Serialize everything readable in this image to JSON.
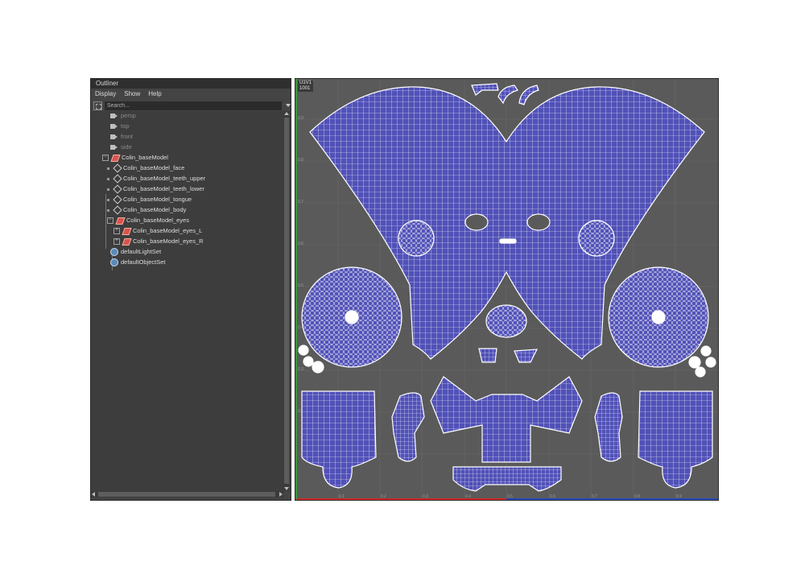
{
  "outliner": {
    "title": "Outliner",
    "menu": [
      "Display",
      "Show",
      "Help"
    ],
    "search_placeholder": "Search...",
    "items": [
      {
        "label": "persp",
        "icon": "camera-icon",
        "dim": true
      },
      {
        "label": "top",
        "icon": "camera-icon",
        "dim": true
      },
      {
        "label": "front",
        "icon": "camera-icon",
        "dim": true
      },
      {
        "label": "side",
        "icon": "camera-icon",
        "dim": true
      },
      {
        "label": "Colin_baseModel",
        "icon": "group-icon",
        "dim": false
      },
      {
        "label": "Colin_baseModel_face",
        "icon": "mesh-icon",
        "dim": false
      },
      {
        "label": "Colin_baseModel_teeth_upper",
        "icon": "mesh-icon",
        "dim": false
      },
      {
        "label": "Colin_baseModel_teeth_lower",
        "icon": "mesh-icon",
        "dim": false
      },
      {
        "label": "Colin_baseModel_tongue",
        "icon": "mesh-icon",
        "dim": false
      },
      {
        "label": "Colin_baseModel_body",
        "icon": "mesh-icon",
        "dim": false
      },
      {
        "label": "Colin_baseModel_eyes",
        "icon": "group-icon",
        "dim": false
      },
      {
        "label": "Colin_baseModel_eyes_L",
        "icon": "group-icon",
        "dim": false
      },
      {
        "label": "Colin_baseModel_eyes_R",
        "icon": "group-icon",
        "dim": false
      },
      {
        "label": "defaultLightSet",
        "icon": "set-icon",
        "dim": false
      },
      {
        "label": "defaultObjectSet",
        "icon": "set-icon",
        "dim": false
      }
    ]
  },
  "uv_editor": {
    "tile_label_line1": "U1V1",
    "tile_label_line2": "1001",
    "v_ticks": [
      "0.9",
      "0.8",
      "0.7",
      "0.6",
      "0.5",
      "0.4",
      "0.3",
      "0.2"
    ],
    "u_ticks": [
      "0.1",
      "0.2",
      "0.3",
      "0.4",
      "0.5",
      "0.6",
      "0.7",
      "0.8",
      "0.9"
    ],
    "colors": {
      "background": "#5a5a5a",
      "uv_fill": "#5151b8",
      "uv_wire": "#ffffff",
      "grid": "#6a6a6a",
      "u_axis": "#cc2a2a",
      "v_axis": "#2aaa2a",
      "u_axis_right": "#2a4ab8"
    }
  }
}
